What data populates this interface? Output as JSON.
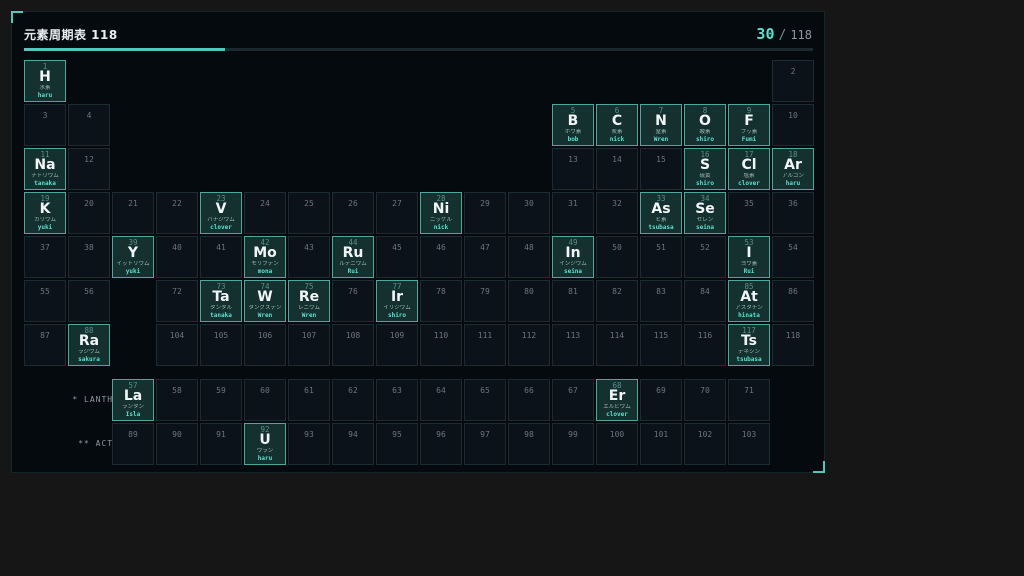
{
  "header": {
    "title": "元素周期表 118",
    "found_count": "30",
    "separator": "/",
    "total_count": "118",
    "progress_fraction": 0.2542
  },
  "series_labels": {
    "lanthanoids": "* LANTHANOIDS",
    "actinoids": "** ACTINOIDS"
  },
  "colors": {
    "accent": "#53c7bb",
    "found_bg": "#14302f",
    "empty_bg": "#0b1219"
  },
  "elements": [
    {
      "n": 1,
      "sym": "H",
      "jp": "水素",
      "user": "haru"
    },
    {
      "n": 2
    },
    {
      "n": 3
    },
    {
      "n": 4
    },
    {
      "n": 5,
      "sym": "B",
      "jp": "ホウ素",
      "user": "bob"
    },
    {
      "n": 6,
      "sym": "C",
      "jp": "炭素",
      "user": "nick"
    },
    {
      "n": 7,
      "sym": "N",
      "jp": "窒素",
      "user": "Wren"
    },
    {
      "n": 8,
      "sym": "O",
      "jp": "酸素",
      "user": "shiro"
    },
    {
      "n": 9,
      "sym": "F",
      "jp": "フッ素",
      "user": "Fumi"
    },
    {
      "n": 10
    },
    {
      "n": 11,
      "sym": "Na",
      "jp": "ナトリウム",
      "user": "tanaka"
    },
    {
      "n": 12
    },
    {
      "n": 13
    },
    {
      "n": 14
    },
    {
      "n": 15
    },
    {
      "n": 16,
      "sym": "S",
      "jp": "硫黄",
      "user": "shiro"
    },
    {
      "n": 17,
      "sym": "Cl",
      "jp": "塩素",
      "user": "clover"
    },
    {
      "n": 18,
      "sym": "Ar",
      "jp": "アルゴン",
      "user": "haru"
    },
    {
      "n": 19,
      "sym": "K",
      "jp": "カリウム",
      "user": "yuki"
    },
    {
      "n": 20
    },
    {
      "n": 21
    },
    {
      "n": 22
    },
    {
      "n": 23,
      "sym": "V",
      "jp": "バナジウム",
      "user": "clover"
    },
    {
      "n": 24
    },
    {
      "n": 25
    },
    {
      "n": 26
    },
    {
      "n": 27
    },
    {
      "n": 28,
      "sym": "Ni",
      "jp": "ニッケル",
      "user": "nick"
    },
    {
      "n": 29
    },
    {
      "n": 30
    },
    {
      "n": 31
    },
    {
      "n": 32
    },
    {
      "n": 33,
      "sym": "As",
      "jp": "ヒ素",
      "user": "tsubasa"
    },
    {
      "n": 34,
      "sym": "Se",
      "jp": "セレン",
      "user": "seina"
    },
    {
      "n": 35
    },
    {
      "n": 36
    },
    {
      "n": 37
    },
    {
      "n": 38
    },
    {
      "n": 39,
      "sym": "Y",
      "jp": "イットリウム",
      "user": "yuki"
    },
    {
      "n": 40
    },
    {
      "n": 41
    },
    {
      "n": 42,
      "sym": "Mo",
      "jp": "モリブデン",
      "user": "mona"
    },
    {
      "n": 43
    },
    {
      "n": 44,
      "sym": "Ru",
      "jp": "ルテニウム",
      "user": "Rui"
    },
    {
      "n": 45
    },
    {
      "n": 46
    },
    {
      "n": 47
    },
    {
      "n": 48
    },
    {
      "n": 49,
      "sym": "In",
      "jp": "インジウム",
      "user": "seina"
    },
    {
      "n": 50
    },
    {
      "n": 51
    },
    {
      "n": 52
    },
    {
      "n": 53,
      "sym": "I",
      "jp": "ヨウ素",
      "user": "Rui"
    },
    {
      "n": 54
    },
    {
      "n": 55
    },
    {
      "n": 56
    },
    {
      "n": 57,
      "sym": "La",
      "jp": "ランタン",
      "user": "Isla"
    },
    {
      "n": 58
    },
    {
      "n": 59
    },
    {
      "n": 60
    },
    {
      "n": 61
    },
    {
      "n": 62
    },
    {
      "n": 63
    },
    {
      "n": 64
    },
    {
      "n": 65
    },
    {
      "n": 66
    },
    {
      "n": 67
    },
    {
      "n": 68,
      "sym": "Er",
      "jp": "エルビウム",
      "user": "clover"
    },
    {
      "n": 69
    },
    {
      "n": 70
    },
    {
      "n": 71
    },
    {
      "n": 72
    },
    {
      "n": 73,
      "sym": "Ta",
      "jp": "タンタル",
      "user": "tanaka"
    },
    {
      "n": 74,
      "sym": "W",
      "jp": "タングステン",
      "user": "Wren"
    },
    {
      "n": 75,
      "sym": "Re",
      "jp": "レニウム",
      "user": "Wren"
    },
    {
      "n": 76
    },
    {
      "n": 77,
      "sym": "Ir",
      "jp": "イリジウム",
      "user": "shiro"
    },
    {
      "n": 78
    },
    {
      "n": 79
    },
    {
      "n": 80
    },
    {
      "n": 81
    },
    {
      "n": 82
    },
    {
      "n": 83
    },
    {
      "n": 84
    },
    {
      "n": 85,
      "sym": "At",
      "jp": "アスタチン",
      "user": "hinata"
    },
    {
      "n": 86
    },
    {
      "n": 87
    },
    {
      "n": 88,
      "sym": "Ra",
      "jp": "ラジウム",
      "user": "sakura"
    },
    {
      "n": 89
    },
    {
      "n": 90
    },
    {
      "n": 91
    },
    {
      "n": 92,
      "sym": "U",
      "jp": "ウラン",
      "user": "haru"
    },
    {
      "n": 93
    },
    {
      "n": 94
    },
    {
      "n": 95
    },
    {
      "n": 96
    },
    {
      "n": 97
    },
    {
      "n": 98
    },
    {
      "n": 99
    },
    {
      "n": 100
    },
    {
      "n": 101
    },
    {
      "n": 102
    },
    {
      "n": 103
    },
    {
      "n": 104
    },
    {
      "n": 105
    },
    {
      "n": 106
    },
    {
      "n": 107
    },
    {
      "n": 108
    },
    {
      "n": 109
    },
    {
      "n": 110
    },
    {
      "n": 111
    },
    {
      "n": 112
    },
    {
      "n": 113
    },
    {
      "n": 114
    },
    {
      "n": 115
    },
    {
      "n": 116
    },
    {
      "n": 117,
      "sym": "Ts",
      "jp": "テネシン",
      "user": "tsubasa"
    },
    {
      "n": 118
    }
  ]
}
